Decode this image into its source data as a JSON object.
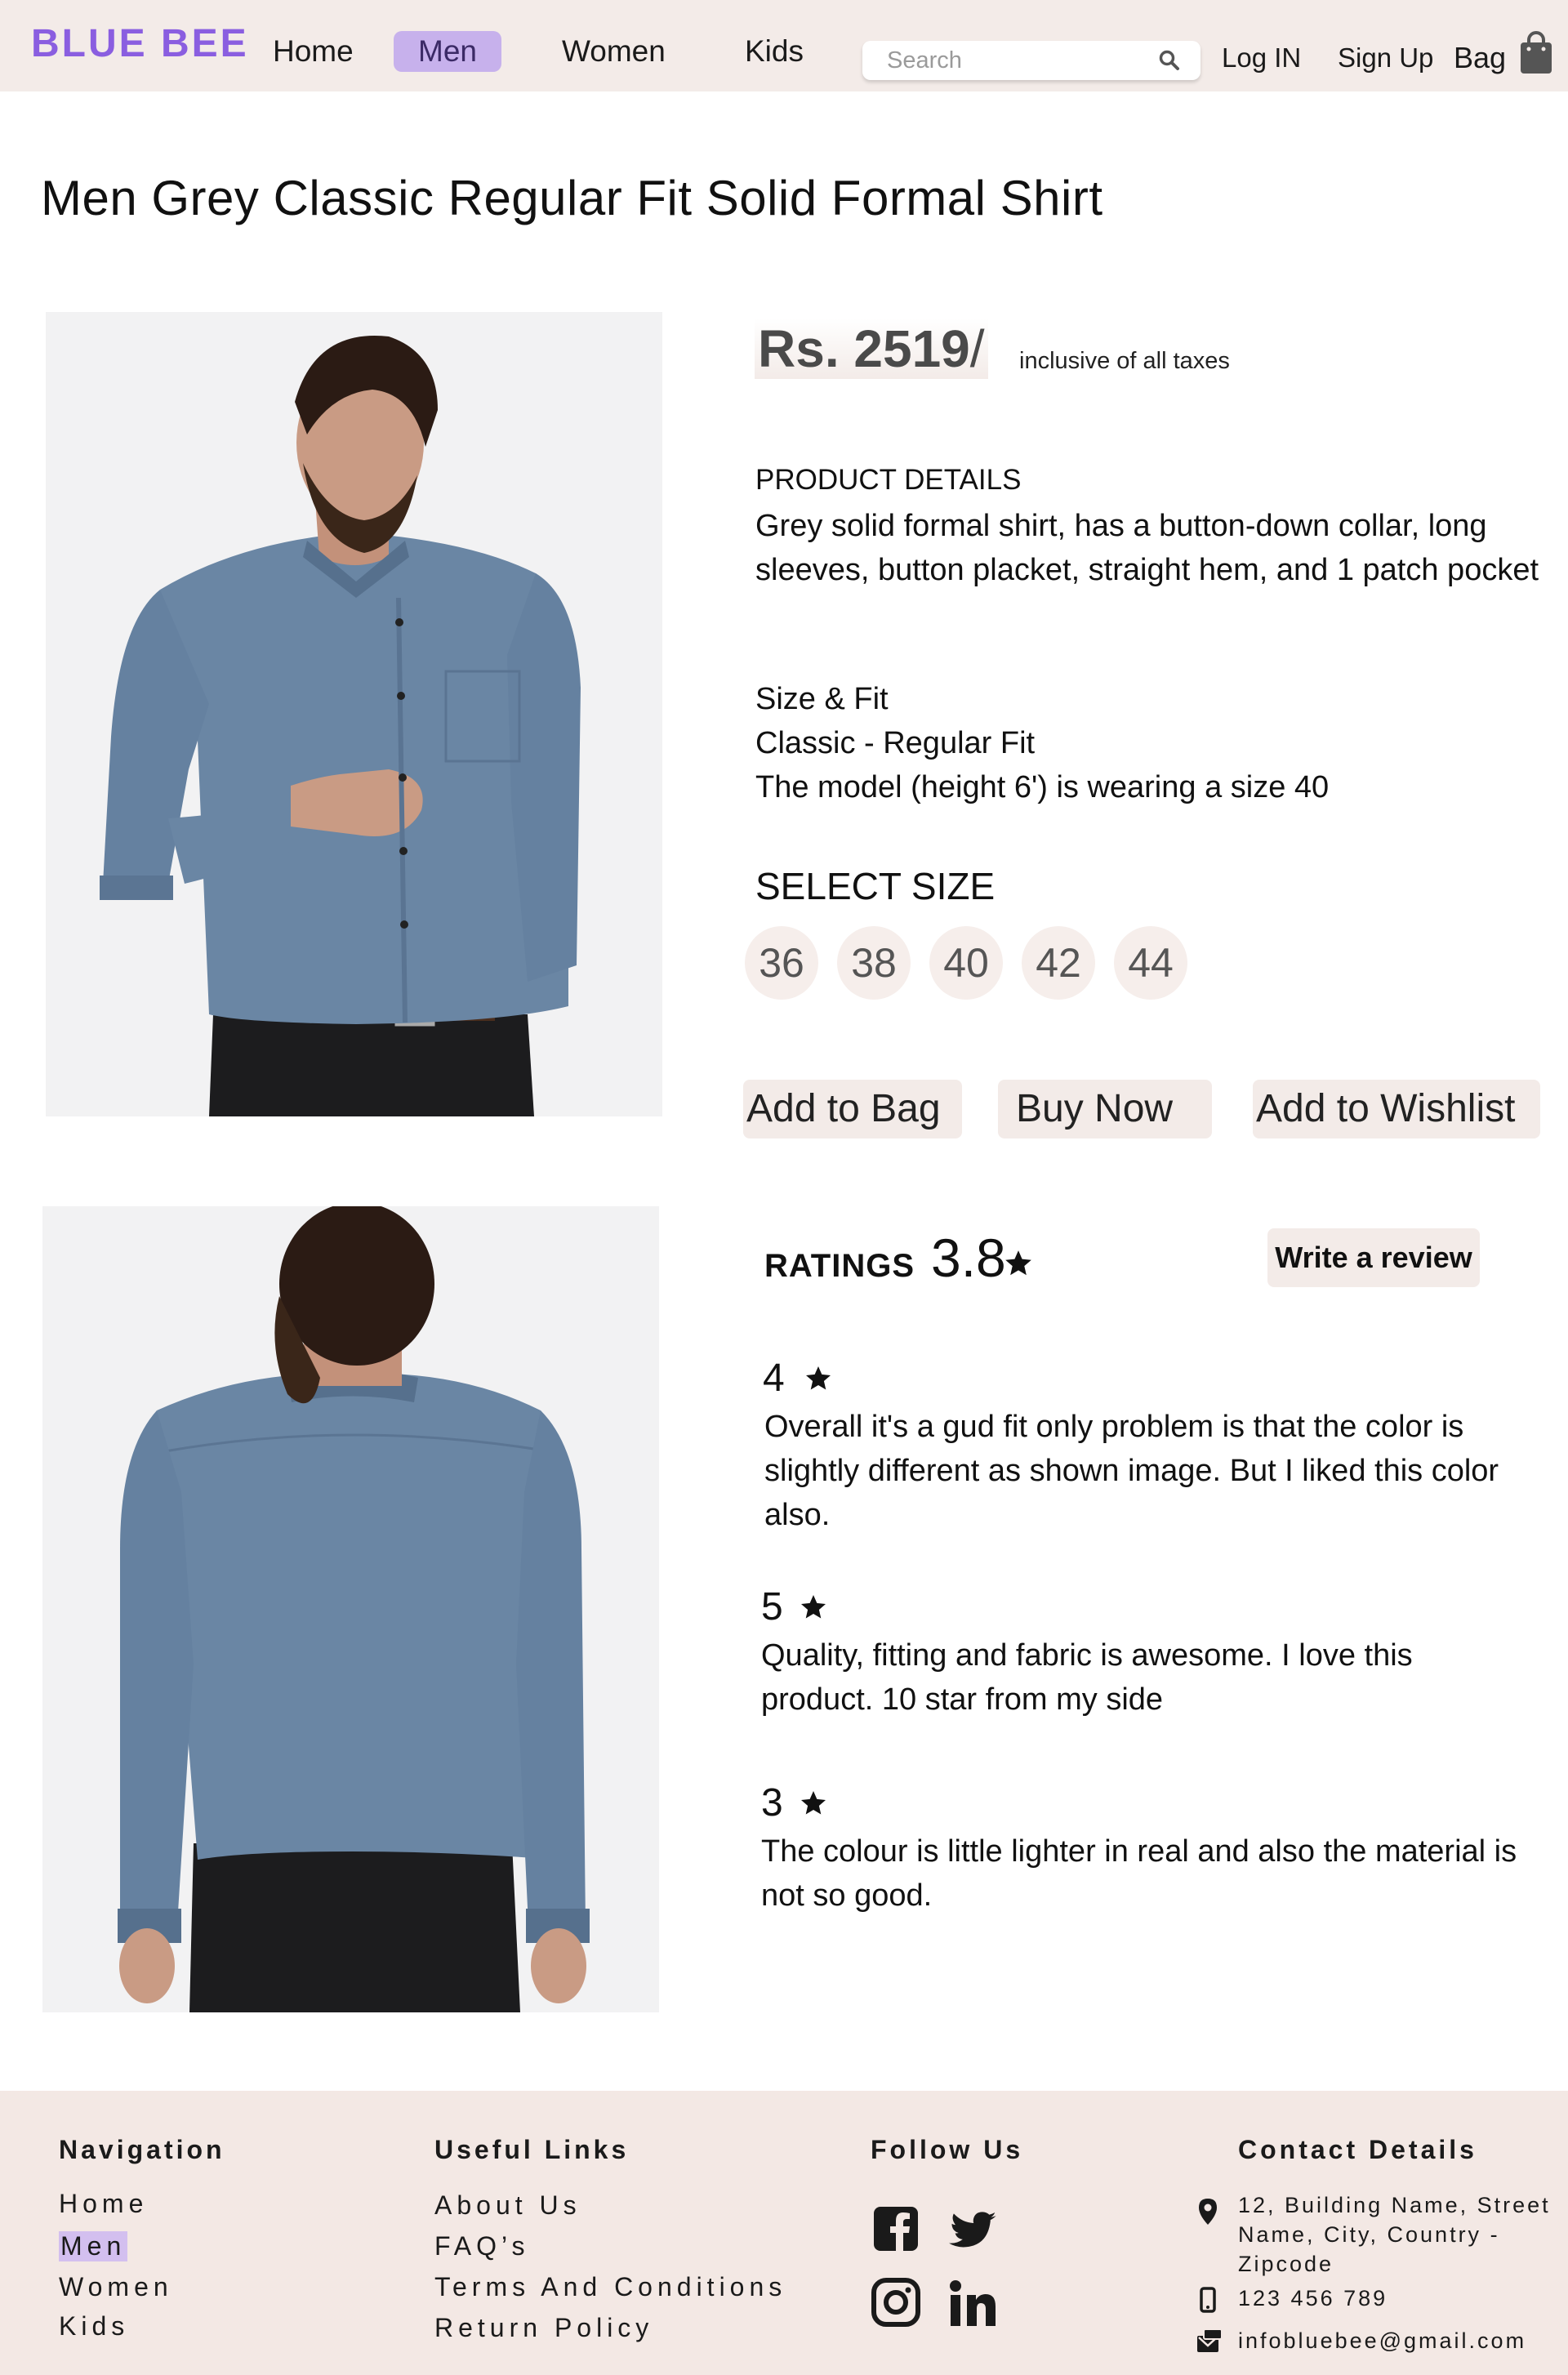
{
  "brand": {
    "name": "BLUE BEE",
    "color": "#8a5ee0"
  },
  "nav": {
    "items": [
      {
        "label": "Home",
        "active": false
      },
      {
        "label": "Men",
        "active": true
      },
      {
        "label": "Women",
        "active": false
      },
      {
        "label": "Kids",
        "active": false
      }
    ],
    "search_placeholder": "Search",
    "login_label": "Log IN",
    "signup_label": "Sign Up",
    "bag_label": "Bag"
  },
  "product": {
    "title": "Men Grey Classic Regular Fit Solid Formal Shirt",
    "price": "Rs. 2519",
    "price_suffix": "/",
    "tax_note": "inclusive of all taxes",
    "details_heading": "PRODUCT DETAILS",
    "details_text": "Grey solid formal shirt, has a button-down collar, long sleeves, button placket, straight hem, and 1 patch pocket",
    "fit_heading": "Size & Fit",
    "fit_type": "Classic - Regular Fit",
    "model_note": "The model (height 6') is wearing a size 40",
    "select_size_label": "SELECT SIZE",
    "sizes": [
      "36",
      "38",
      "40",
      "42",
      "44"
    ],
    "actions": {
      "add_to_bag": "Add to Bag",
      "buy_now": "Buy Now",
      "add_to_wishlist": "Add to Wishlist"
    }
  },
  "ratings": {
    "label": "RATINGS",
    "average": "3.8",
    "write_review_label": "Write a review",
    "reviews": [
      {
        "score": "4",
        "text": "Overall it's a gud fit only problem is that the color is slightly different as shown image. But I liked this color also."
      },
      {
        "score": "5",
        "text": "Quality, fitting and fabric is awesome. I love this product. 10 star from my side"
      },
      {
        "score": "3",
        "text": "The colour is little lighter in real and also the material is not so good."
      }
    ]
  },
  "footer": {
    "navigation": {
      "heading": "Navigation",
      "links": [
        "Home",
        "Men",
        "Women",
        "Kids"
      ]
    },
    "useful_links": {
      "heading": "Useful  Links",
      "links": [
        "About Us",
        "FAQ’s",
        "Terms And Conditions",
        "Return Policy"
      ]
    },
    "follow_us": {
      "heading": "Follow Us",
      "icons": [
        "facebook-icon",
        "twitter-icon",
        "instagram-icon",
        "linkedin-icon"
      ]
    },
    "contact": {
      "heading": "Contact Details",
      "address": "12, Building Name, Street Name, City, Country - Zipcode",
      "phone": "123 456 789",
      "email": "infobluebee@gmail.com"
    }
  },
  "colors": {
    "nav_bg": "#f3ebe8",
    "active_pill": "#c7b1ec",
    "button_bg": "#f3ebe8",
    "footer_bg": "#f3e8e4",
    "shirt": "#6a86a4"
  }
}
